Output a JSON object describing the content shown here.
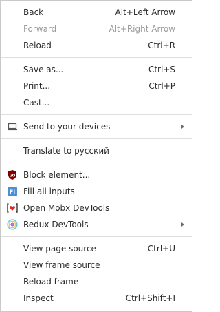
{
  "menu": {
    "items": {
      "back": {
        "label": "Back",
        "shortcut": "Alt+Left Arrow"
      },
      "forward": {
        "label": "Forward",
        "shortcut": "Alt+Right Arrow"
      },
      "reload": {
        "label": "Reload",
        "shortcut": "Ctrl+R"
      },
      "save_as": {
        "label": "Save as...",
        "shortcut": "Ctrl+S"
      },
      "print": {
        "label": "Print...",
        "shortcut": "Ctrl+P"
      },
      "cast": {
        "label": "Cast..."
      },
      "send_to_devices": {
        "label": "Send to your devices",
        "icon": "laptop-icon"
      },
      "translate": {
        "label": "Translate to русский"
      },
      "block_element": {
        "label": "Block element...",
        "icon": "ublock-origin-icon"
      },
      "fill_all_inputs": {
        "label": "Fill all inputs",
        "icon": "fake-filler-icon"
      },
      "mobx_devtools": {
        "label": "Open Mobx DevTools",
        "icon": "mobx-icon"
      },
      "redux_devtools": {
        "label": "Redux DevTools",
        "icon": "redux-icon"
      },
      "view_page_source": {
        "label": "View page source",
        "shortcut": "Ctrl+U"
      },
      "view_frame_source": {
        "label": "View frame source"
      },
      "reload_frame": {
        "label": "Reload frame"
      },
      "inspect": {
        "label": "Inspect",
        "shortcut": "Ctrl+Shift+I"
      }
    }
  },
  "colors": {
    "text": "#2b2b2b",
    "disabled_text": "#9a9a9a",
    "separator": "#dedede",
    "ublock_red": "#800000",
    "filler_blue": "#4a90d9",
    "mobx_red": "#e2252b"
  }
}
